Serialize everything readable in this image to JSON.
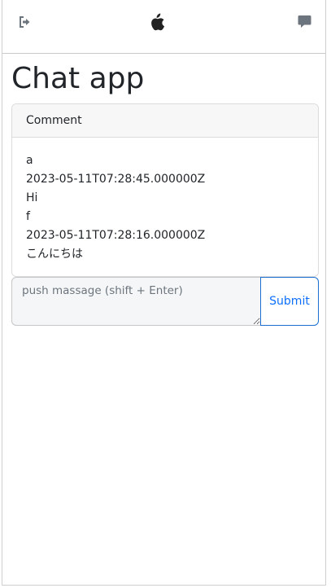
{
  "app": {
    "title": "Chat app"
  },
  "topbar": {
    "left_icon": "logout-icon",
    "center_icon": "apple-icon",
    "right_icon": "comment-icon"
  },
  "comments": {
    "header": "Comment",
    "messages": [
      {
        "user": "a",
        "timestamp": "2023-05-11T07:28:45.000000Z",
        "text": "Hi"
      },
      {
        "user": "f",
        "timestamp": "2023-05-11T07:28:16.000000Z",
        "text": "こんにちは"
      }
    ]
  },
  "composer": {
    "placeholder": "push massage (shift + Enter)",
    "value": "",
    "submit_label": "Submit"
  },
  "colors": {
    "accent": "#0d6efd",
    "icon": "#6c757d"
  }
}
